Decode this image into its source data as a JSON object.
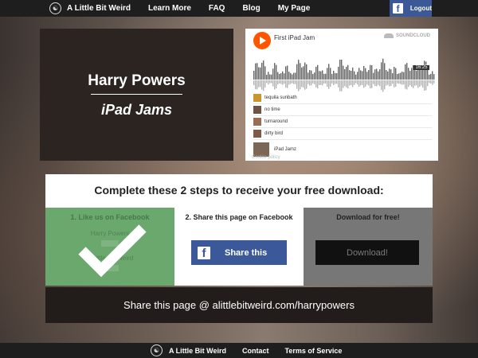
{
  "nav": {
    "brand": "A Little Bit Weird",
    "links": [
      "Learn More",
      "FAQ",
      "Blog",
      "My Page"
    ],
    "logout": "Logout"
  },
  "hero": {
    "artist": "Harry Powers",
    "album": "iPad Jams"
  },
  "player": {
    "track_title": "First iPad Jam",
    "brand": "SOUNDCLOUD",
    "duration": "16:25",
    "tracks": [
      "tequila sunbath",
      "no time",
      "turnaround",
      "dirty bird"
    ],
    "playlist": "iPad Jamz",
    "cookie": "Cookie policy"
  },
  "steps": {
    "heading": "Complete these 2 steps to receive your free download:",
    "step1": {
      "title": "1. Like us on Facebook",
      "ghost1": "Harry Powers",
      "ghost2": "A Little Bit Weird",
      "completed": true
    },
    "step2": {
      "title": "2. Share this page on Facebook",
      "button": "Share this"
    },
    "step3": {
      "title": "Download for free!",
      "button": "Download!"
    }
  },
  "share_banner": "Share this page @ alittlebitweird.com/harrypowers",
  "footer": {
    "brand": "A Little Bit Weird",
    "links": [
      "Contact",
      "Terms of Service"
    ]
  },
  "colors": {
    "facebook": "#3b5998",
    "soundcloud": "#ff5500",
    "step_done": "#6ba86e"
  }
}
